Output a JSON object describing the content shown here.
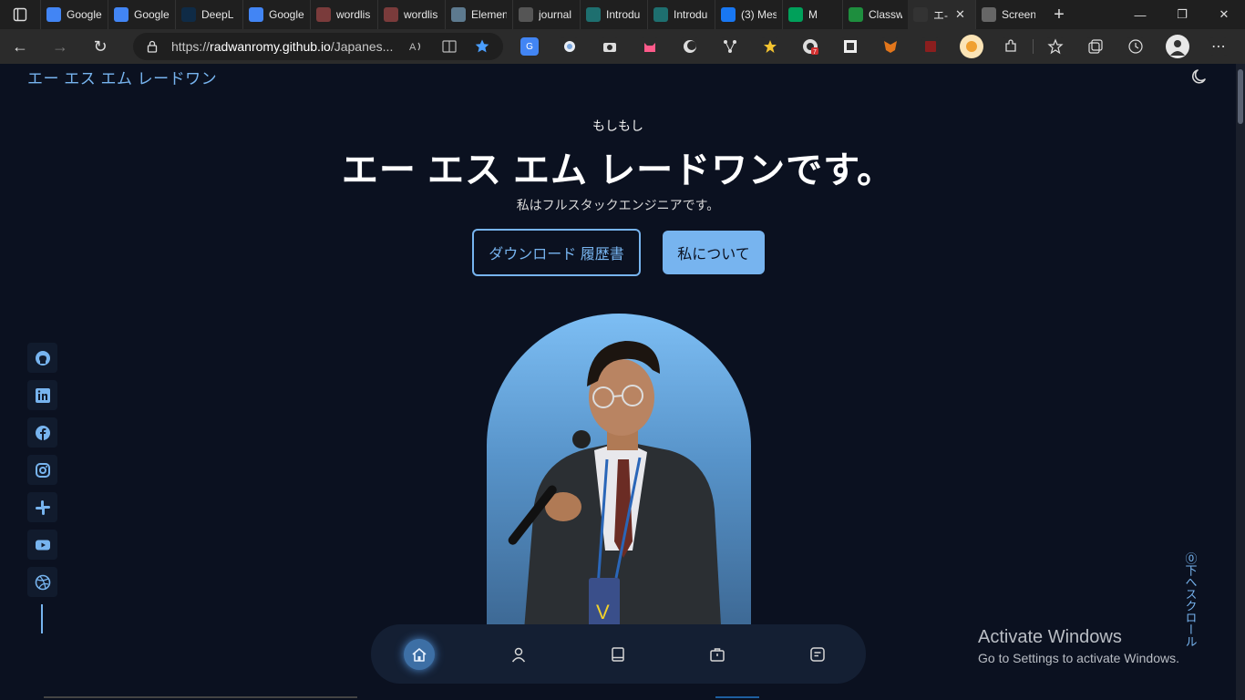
{
  "browser": {
    "tabs": [
      {
        "title": "Google",
        "favicon": "google-translate-icon",
        "color": "#4285f4"
      },
      {
        "title": "Google",
        "favicon": "google-translate-icon",
        "color": "#4285f4"
      },
      {
        "title": "DeepL",
        "favicon": "deepl-icon",
        "color": "#0f2b46"
      },
      {
        "title": "Google",
        "favicon": "google-translate-icon",
        "color": "#4285f4"
      },
      {
        "title": "wordlis",
        "favicon": "pdf-icon",
        "color": "#7a3b3b"
      },
      {
        "title": "wordlis",
        "favicon": "pdf-icon",
        "color": "#7a3b3b"
      },
      {
        "title": "Elemen",
        "favicon": "elements-icon",
        "color": "#5d7a8f"
      },
      {
        "title": "journal",
        "favicon": "journal-icon",
        "color": "#555"
      },
      {
        "title": "Introdu",
        "favicon": "introduction-icon",
        "color": "#1e6f6f"
      },
      {
        "title": "Introdu",
        "favicon": "introduction-icon",
        "color": "#1e6f6f"
      },
      {
        "title": "(3) Mes",
        "favicon": "facebook-icon",
        "color": "#1877f2"
      },
      {
        "title": "M",
        "favicon": "meet-icon",
        "color": "#00a05a"
      },
      {
        "title": "Classw",
        "favicon": "classroom-icon",
        "color": "#1e8e3e"
      },
      {
        "title": "エ-",
        "favicon": "portfolio-icon",
        "color": "#333"
      },
      {
        "title": "Screen",
        "favicon": "camera-icon",
        "color": "#666"
      }
    ],
    "active_tab_index": 13,
    "url_prefix": "https://",
    "url_host": "radwanromy.github.io",
    "url_path": "/Japanes..."
  },
  "site": {
    "brand": "エー エス エム レードワン",
    "greeting": "もしもし",
    "title": "エー エス エム レードワンです。",
    "subtitle": "私はフルスタックエンジニアです。",
    "download_button": "ダウンロード 履歴書",
    "about_button": "私について",
    "scroll_label": "下へスクロール",
    "accent": "#77b4ef",
    "background": "#0b1120"
  },
  "socials": [
    "github-icon",
    "linkedin-icon",
    "facebook-icon",
    "instagram-icon",
    "slack-icon",
    "youtube-icon",
    "dribbble-icon"
  ],
  "bottom_nav": [
    "home-icon",
    "user-icon",
    "book-icon",
    "briefcase-icon",
    "message-icon"
  ],
  "watermark": {
    "line1": "Activate Windows",
    "line2": "Go to Settings to activate Windows."
  }
}
